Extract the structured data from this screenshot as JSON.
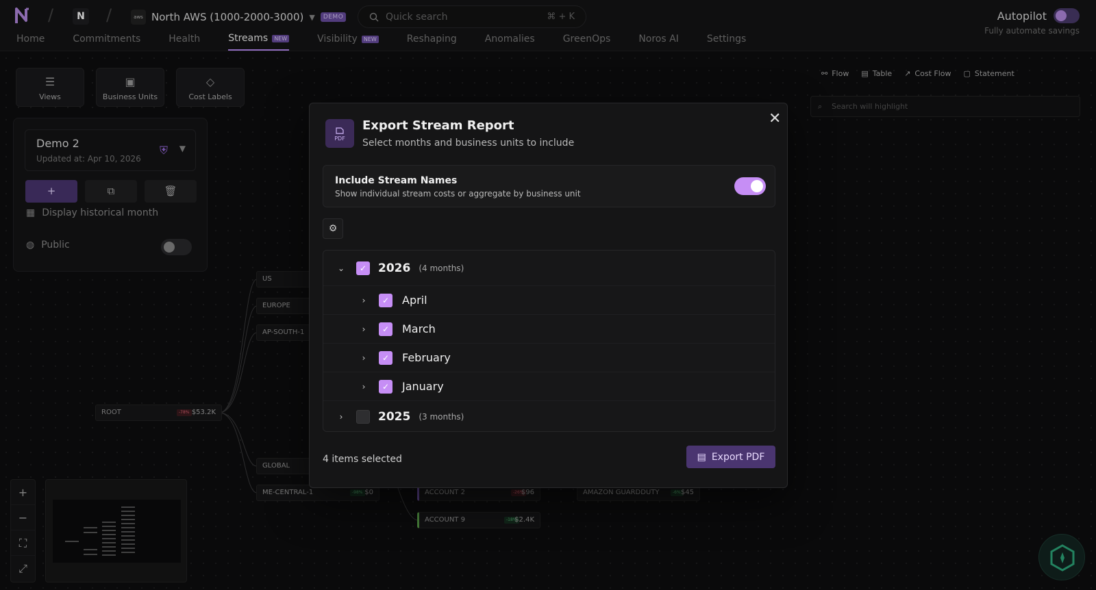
{
  "topbar": {
    "org_initial": "N",
    "account_provider": "aws",
    "account_name": "North AWS (1000-2000-3000)",
    "account_tag": "DEMO",
    "search_placeholder": "Quick search",
    "search_shortcut": "⌘ + K",
    "autopilot_title": "Autopilot",
    "autopilot_subtitle": "Fully automate savings"
  },
  "nav": [
    {
      "label": "Home",
      "active": false,
      "tag": ""
    },
    {
      "label": "Commitments",
      "active": false,
      "tag": ""
    },
    {
      "label": "Health",
      "active": false,
      "tag": ""
    },
    {
      "label": "Streams",
      "active": true,
      "tag": "NEW"
    },
    {
      "label": "Visibility",
      "active": false,
      "tag": "NEW"
    },
    {
      "label": "Reshaping",
      "active": false,
      "tag": ""
    },
    {
      "label": "Anomalies",
      "active": false,
      "tag": ""
    },
    {
      "label": "GreenOps",
      "active": false,
      "tag": ""
    },
    {
      "label": "Noros AI",
      "active": false,
      "tag": ""
    },
    {
      "label": "Settings",
      "active": false,
      "tag": ""
    }
  ],
  "tools": {
    "views": "Views",
    "business_units": "Business Units",
    "cost_labels": "Cost Labels"
  },
  "left_panel": {
    "view_name": "Demo 2",
    "updated": "Updated at: Apr 10, 2026",
    "historical_label": "Display historical month",
    "public_label": "Public"
  },
  "nodes": {
    "root": {
      "label": "ROOT",
      "pct": "-78%",
      "amount": "$53.2K"
    },
    "us": "US",
    "europe": "EUROPE",
    "ap_south": "AP-SOUTH-1",
    "global": "GLOBAL",
    "me_central": {
      "label": "ME-CENTRAL-1",
      "pct": "-98%",
      "amount": "$0"
    },
    "account2": {
      "label": "ACCOUNT 2",
      "pct": "-26%",
      "amount": "$96"
    },
    "account9": {
      "label": "ACCOUNT 9",
      "pct": "-18%",
      "amount": "$2.4K"
    },
    "guardduty": {
      "label": "AMAZON GUARDDUTY",
      "pct": "-6%",
      "amount": "$45"
    }
  },
  "right_toolbar": {
    "flow": "Flow",
    "table": "Table",
    "cost_flow": "Cost Flow",
    "statement": "Statement",
    "search_placeholder": "Search will highlight"
  },
  "modal": {
    "icon_text": "PDF",
    "title": "Export Stream Report",
    "subtitle": "Select months and business units to include",
    "include_title": "Include Stream Names",
    "include_desc": "Show individual stream costs or aggregate by business unit",
    "include_enabled": true,
    "years": [
      {
        "year": "2026",
        "count": "(4 months)",
        "expanded": true,
        "checked": true,
        "months": [
          {
            "name": "April",
            "checked": true
          },
          {
            "name": "March",
            "checked": true
          },
          {
            "name": "February",
            "checked": true
          },
          {
            "name": "January",
            "checked": true
          }
        ]
      },
      {
        "year": "2025",
        "count": "(3 months)",
        "expanded": false,
        "checked": false,
        "months": []
      }
    ],
    "selected_count": "4 items selected",
    "export_label": "Export PDF"
  },
  "colors": {
    "accent": "#c68ef5",
    "accent_dark": "#4a3570",
    "background": "#0d0d0e"
  }
}
